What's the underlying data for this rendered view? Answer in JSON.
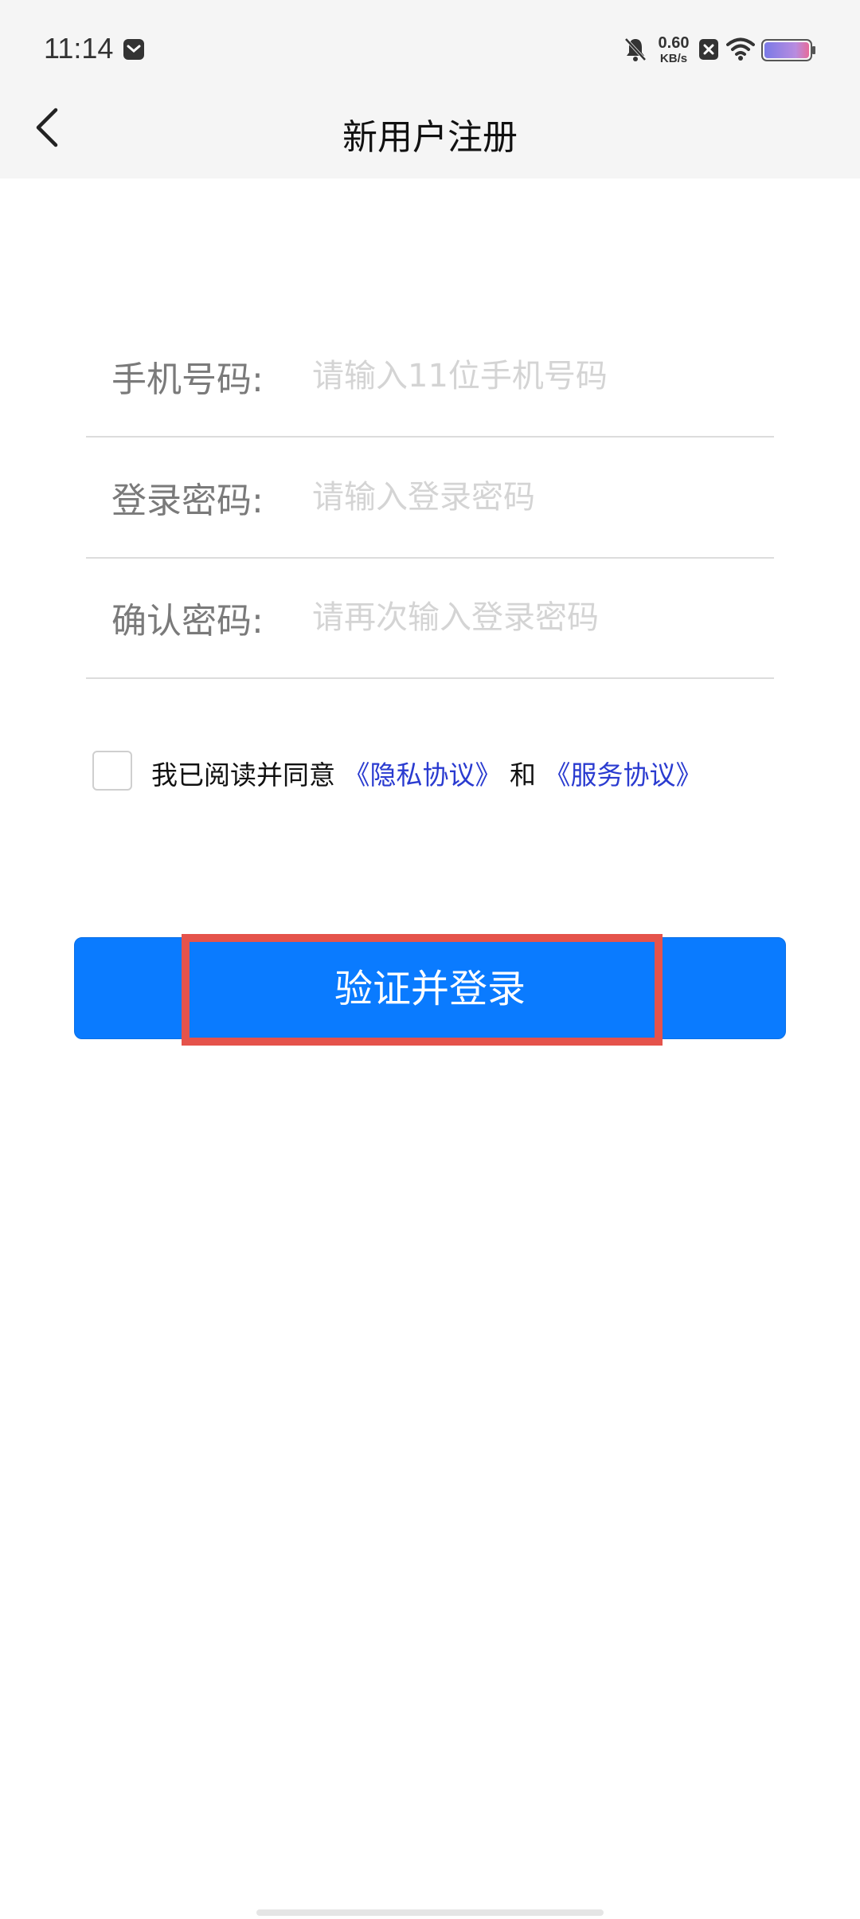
{
  "status_bar": {
    "time": "11:14",
    "net_speed_value": "0.60",
    "net_speed_unit": "KB/s",
    "icons": [
      "message-icon",
      "bell-off-icon",
      "x-box-icon",
      "wifi-icon",
      "battery-icon"
    ]
  },
  "header": {
    "back_icon": "chevron-left-icon",
    "title": "新用户注册"
  },
  "form": {
    "phone": {
      "label": "手机号码:",
      "placeholder": "请输入11位手机号码",
      "value": ""
    },
    "password": {
      "label": "登录密码:",
      "placeholder": "请输入登录密码",
      "value": ""
    },
    "confirm": {
      "label": "确认密码:",
      "placeholder": "请再次输入登录密码",
      "value": ""
    }
  },
  "agreement": {
    "checked": false,
    "prefix": "我已阅读并同意",
    "privacy": "《隐私协议》",
    "and": "和",
    "service": "《服务协议》"
  },
  "submit_label": "验证并登录",
  "colors": {
    "accent": "#0a7bff",
    "link": "#2a3bd0",
    "highlight": "#e5534b",
    "header_bg": "#f5f5f5"
  }
}
